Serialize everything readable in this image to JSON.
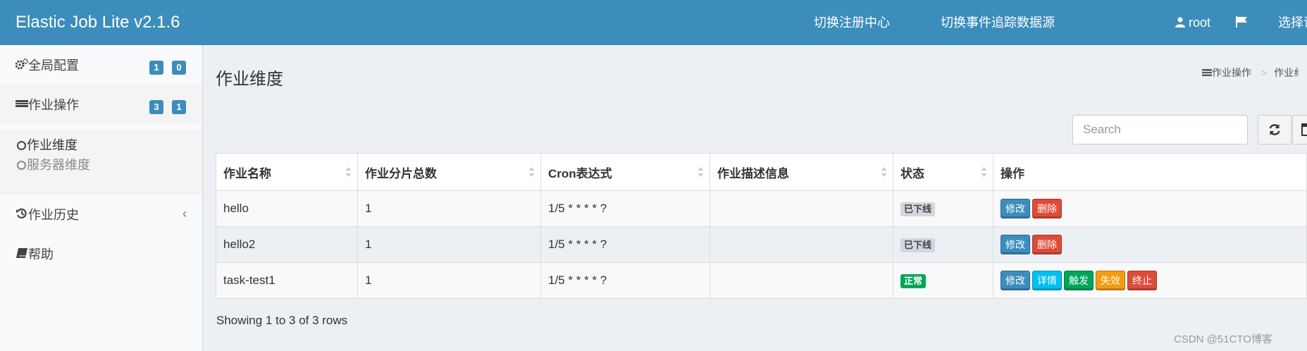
{
  "app": {
    "title": "Elastic Job Lite v2.1.6"
  },
  "topnav": {
    "switch_registry": "切换注册中心",
    "switch_datasource": "切换事件追踪数据源",
    "user": "root",
    "language": "选择语"
  },
  "sidebar": {
    "global_config": {
      "label": "全局配置",
      "badges": [
        "1",
        "0"
      ]
    },
    "job_ops": {
      "label": "作业操作",
      "badges": [
        "3",
        "1"
      ]
    },
    "job_ops_sub": [
      "作业维度",
      "服务器维度"
    ],
    "job_history": {
      "label": "作业历史"
    },
    "help": {
      "label": "帮助"
    }
  },
  "main": {
    "page_title": "作业维度",
    "breadcrumb": [
      "作业操作",
      "作业纟"
    ],
    "search_placeholder": "Search",
    "table": {
      "headers": [
        "作业名称",
        "作业分片总数",
        "Cron表达式",
        "作业描述信息",
        "状态",
        "操作"
      ],
      "rows": [
        {
          "name": "hello",
          "shards": "1",
          "cron": "1/5 * * * * ?",
          "desc": "",
          "status": "已下线",
          "actions": [
            "修改",
            "删除"
          ]
        },
        {
          "name": "hello2",
          "shards": "1",
          "cron": "1/5 * * * * ?",
          "desc": "",
          "status": "已下线",
          "actions": [
            "修改",
            "删除"
          ]
        },
        {
          "name": "task-test1",
          "shards": "1",
          "cron": "1/5 * * * * ?",
          "desc": "",
          "status": "正常",
          "actions": [
            "修改",
            "详情",
            "触发",
            "失效",
            "终止"
          ]
        }
      ]
    },
    "pagination_info": "Showing 1 to 3 of 3 rows"
  },
  "watermark": "CSDN @51CTO博客",
  "colors": {
    "header": "#3c8dbc",
    "badge": "#3c8dbc",
    "status_offline": "#d2d6de",
    "status_normal": "#00a65a",
    "btn_edit": "#3c8dbc",
    "btn_delete": "#dd4b39",
    "btn_detail": "#00c0ef",
    "btn_trigger": "#00a65a",
    "btn_disable": "#f39c12",
    "btn_shutdown": "#dd4b39"
  },
  "icons": {
    "user": "user-icon",
    "flag": "flag-icon",
    "global_config": "gears-icon",
    "job_ops": "list-icon",
    "job_history": "history-icon",
    "help": "book-icon",
    "refresh": "refresh-icon",
    "columns": "columns-icon"
  }
}
